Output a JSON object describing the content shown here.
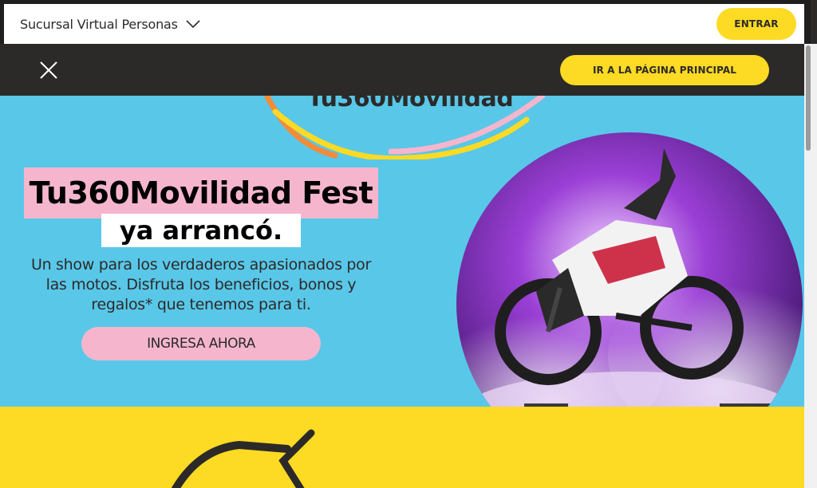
{
  "topbar": {
    "branch_label": "Sucursal Virtual Personas",
    "branch_icon": "chevron-down-icon",
    "enter_label": "ENTRAR"
  },
  "darkbar": {
    "close_icon": "close-icon",
    "home_label": "IR A LA PÁGINA PRINCIPAL"
  },
  "hero": {
    "logo_text": "Tu360Movilidad",
    "title_line1": "Tu360Movilidad Fest",
    "title_line2": "ya arrancó.",
    "subtitle": "Un show para los verdaderos apasionados por las motos. Disfruta los beneficios, bonos y regalos* que tenemos para ti.",
    "cta_label": "INGRESA AHORA",
    "image": "motorcycle-image"
  },
  "colors": {
    "brand_yellow": "#fdda24",
    "dark": "#2c2a29",
    "hero_blue": "#59c7e8",
    "pink": "#f5b6cd"
  }
}
